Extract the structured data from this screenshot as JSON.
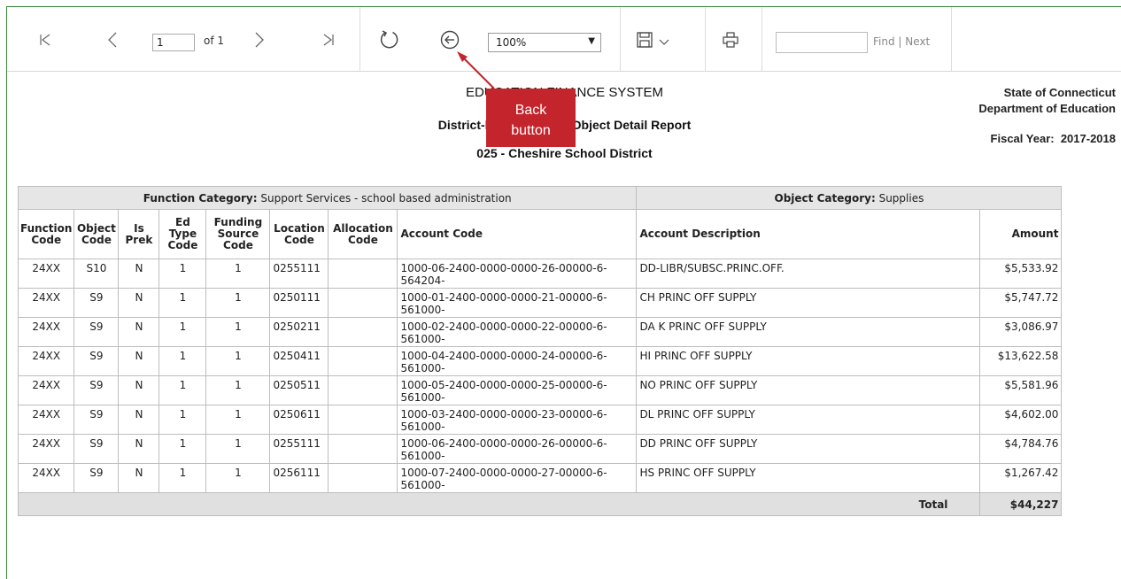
{
  "toolbar": {
    "page_number": "1",
    "of_label": "of 1",
    "zoom_value": "100%",
    "find_placeholder": "",
    "find_label": "Find",
    "next_label": "Next",
    "link_separator": "|"
  },
  "callout": {
    "line1": "Back",
    "line2": "button",
    "color": "#c4242b"
  },
  "report_header": {
    "title": "EDUCATION FINANCE SYSTEM",
    "subtitle": "District-level Function/Object Detail Report",
    "district": "025 - Cheshire School District",
    "agency_line1": "State of Connecticut",
    "agency_line2": "Department of Education",
    "fiscal_year_label": "Fiscal Year:",
    "fiscal_year": "2017-2018"
  },
  "table": {
    "function_category_label": "Function Category:",
    "function_category_value": "Support Services - school based administration",
    "object_category_label": "Object Category:",
    "object_category_value": "Supplies",
    "headers": {
      "function_code": "Function Code",
      "object_code": "Object Code",
      "is_prek": "Is Prek",
      "ed_type_code": "Ed Type Code",
      "funding_source_code": "Funding Source Code",
      "location_code": "Location Code",
      "allocation_code": "Allocation Code",
      "account_code": "Account Code",
      "account_description": "Account Description",
      "amount": "Amount"
    },
    "rows": [
      {
        "function_code": "24XX",
        "object_code": "S10",
        "is_prek": "N",
        "ed_type": "1",
        "funding": "1",
        "location": "0255111",
        "allocation": "",
        "account_code_1": "1000-06-2400-0000-0000-26-00000-6-",
        "account_code_2": "564204-",
        "description": "DD-LIBR/SUBSC.PRINC.OFF.",
        "amount": "$5,533.92"
      },
      {
        "function_code": "24XX",
        "object_code": "S9",
        "is_prek": "N",
        "ed_type": "1",
        "funding": "1",
        "location": "0250111",
        "allocation": "",
        "account_code_1": "1000-01-2400-0000-0000-21-00000-6-",
        "account_code_2": "561000-",
        "description": "CH PRINC OFF SUPPLY",
        "amount": "$5,747.72"
      },
      {
        "function_code": "24XX",
        "object_code": "S9",
        "is_prek": "N",
        "ed_type": "1",
        "funding": "1",
        "location": "0250211",
        "allocation": "",
        "account_code_1": "1000-02-2400-0000-0000-22-00000-6-",
        "account_code_2": "561000-",
        "description": "DA K PRINC OFF SUPPLY",
        "amount": "$3,086.97"
      },
      {
        "function_code": "24XX",
        "object_code": "S9",
        "is_prek": "N",
        "ed_type": "1",
        "funding": "1",
        "location": "0250411",
        "allocation": "",
        "account_code_1": "1000-04-2400-0000-0000-24-00000-6-",
        "account_code_2": "561000-",
        "description": "HI PRINC OFF SUPPLY",
        "amount": "$13,622.58"
      },
      {
        "function_code": "24XX",
        "object_code": "S9",
        "is_prek": "N",
        "ed_type": "1",
        "funding": "1",
        "location": "0250511",
        "allocation": "",
        "account_code_1": "1000-05-2400-0000-0000-25-00000-6-",
        "account_code_2": "561000-",
        "description": "NO PRINC OFF SUPPLY",
        "amount": "$5,581.96"
      },
      {
        "function_code": "24XX",
        "object_code": "S9",
        "is_prek": "N",
        "ed_type": "1",
        "funding": "1",
        "location": "0250611",
        "allocation": "",
        "account_code_1": "1000-03-2400-0000-0000-23-00000-6-",
        "account_code_2": "561000-",
        "description": "DL PRINC OFF SUPPLY",
        "amount": "$4,602.00"
      },
      {
        "function_code": "24XX",
        "object_code": "S9",
        "is_prek": "N",
        "ed_type": "1",
        "funding": "1",
        "location": "0255111",
        "allocation": "",
        "account_code_1": "1000-06-2400-0000-0000-26-00000-6-",
        "account_code_2": "561000-",
        "description": "DD PRINC OFF SUPPLY",
        "amount": "$4,784.76"
      },
      {
        "function_code": "24XX",
        "object_code": "S9",
        "is_prek": "N",
        "ed_type": "1",
        "funding": "1",
        "location": "0256111",
        "allocation": "",
        "account_code_1": "1000-07-2400-0000-0000-27-00000-6-",
        "account_code_2": "561000-",
        "description": "HS PRINC OFF SUPPLY",
        "amount": "$1,267.42"
      }
    ],
    "total_label": "Total",
    "total_value": "$44,227"
  }
}
